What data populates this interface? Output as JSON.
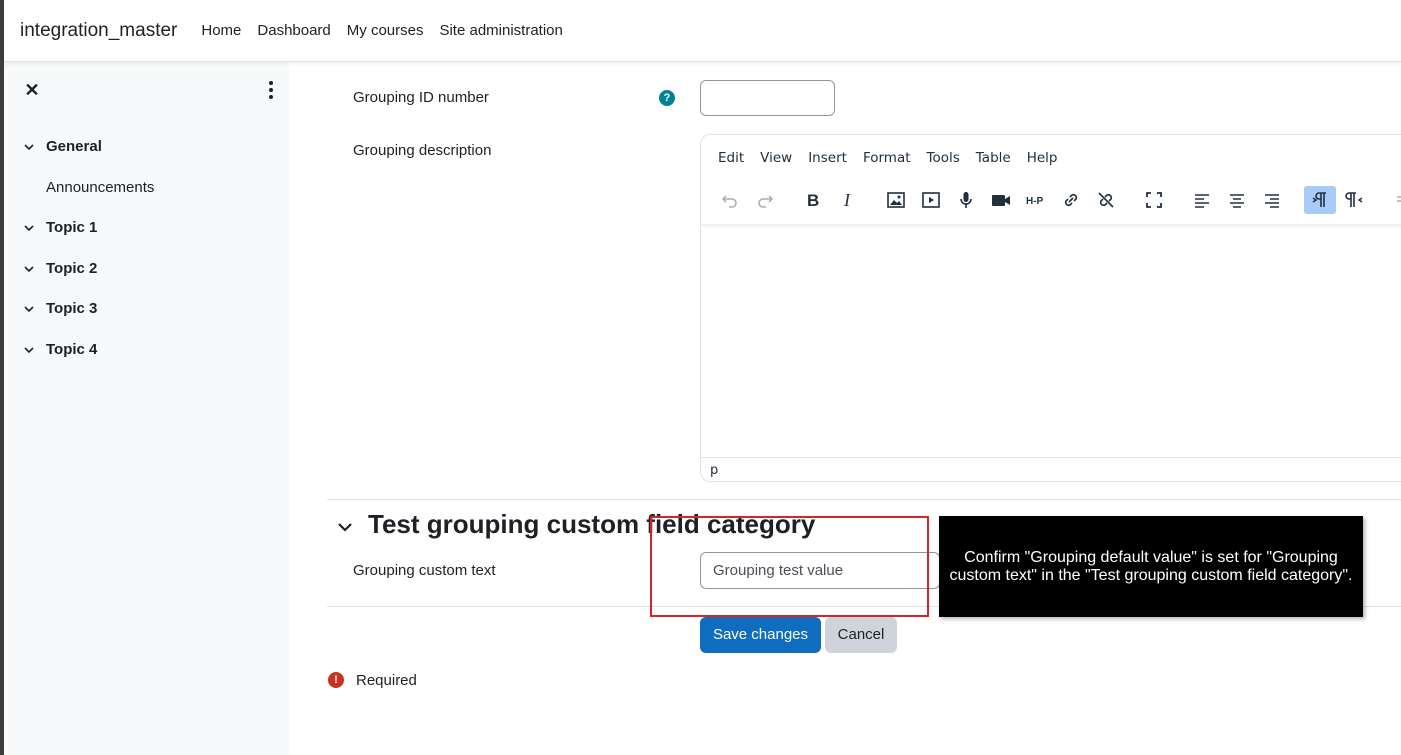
{
  "navbar": {
    "brand": "integration_master",
    "links": [
      "Home",
      "Dashboard",
      "My courses",
      "Site administration"
    ]
  },
  "drawer": {
    "close_icon": "close-icon",
    "menu_icon": "kebab-menu-icon",
    "sections": [
      {
        "label": "General",
        "items": [
          "Announcements"
        ]
      },
      {
        "label": "Topic 1",
        "items": []
      },
      {
        "label": "Topic 2",
        "items": []
      },
      {
        "label": "Topic 3",
        "items": []
      },
      {
        "label": "Topic 4",
        "items": []
      }
    ]
  },
  "form": {
    "idnumber_label": "Grouping ID number",
    "idnumber_value": "",
    "description_label": "Grouping description",
    "editor": {
      "menus": [
        "Edit",
        "View",
        "Insert",
        "Format",
        "Tools",
        "Table",
        "Help"
      ],
      "status_path": "p"
    },
    "category_title": "Test grouping custom field category",
    "custom_text_label": "Grouping custom text",
    "custom_text_value": "Grouping test value",
    "save_label": "Save changes",
    "cancel_label": "Cancel",
    "required_label": "Required"
  },
  "annotation": {
    "tooltip_text": "Confirm \"Grouping default value\" is set for \"Grouping custom text\" in the \"Test grouping custom field category\"."
  },
  "colors": {
    "primary": "#0f6cbf",
    "help": "#008196",
    "required": "#ca3120",
    "highlight": "#d8232a"
  }
}
